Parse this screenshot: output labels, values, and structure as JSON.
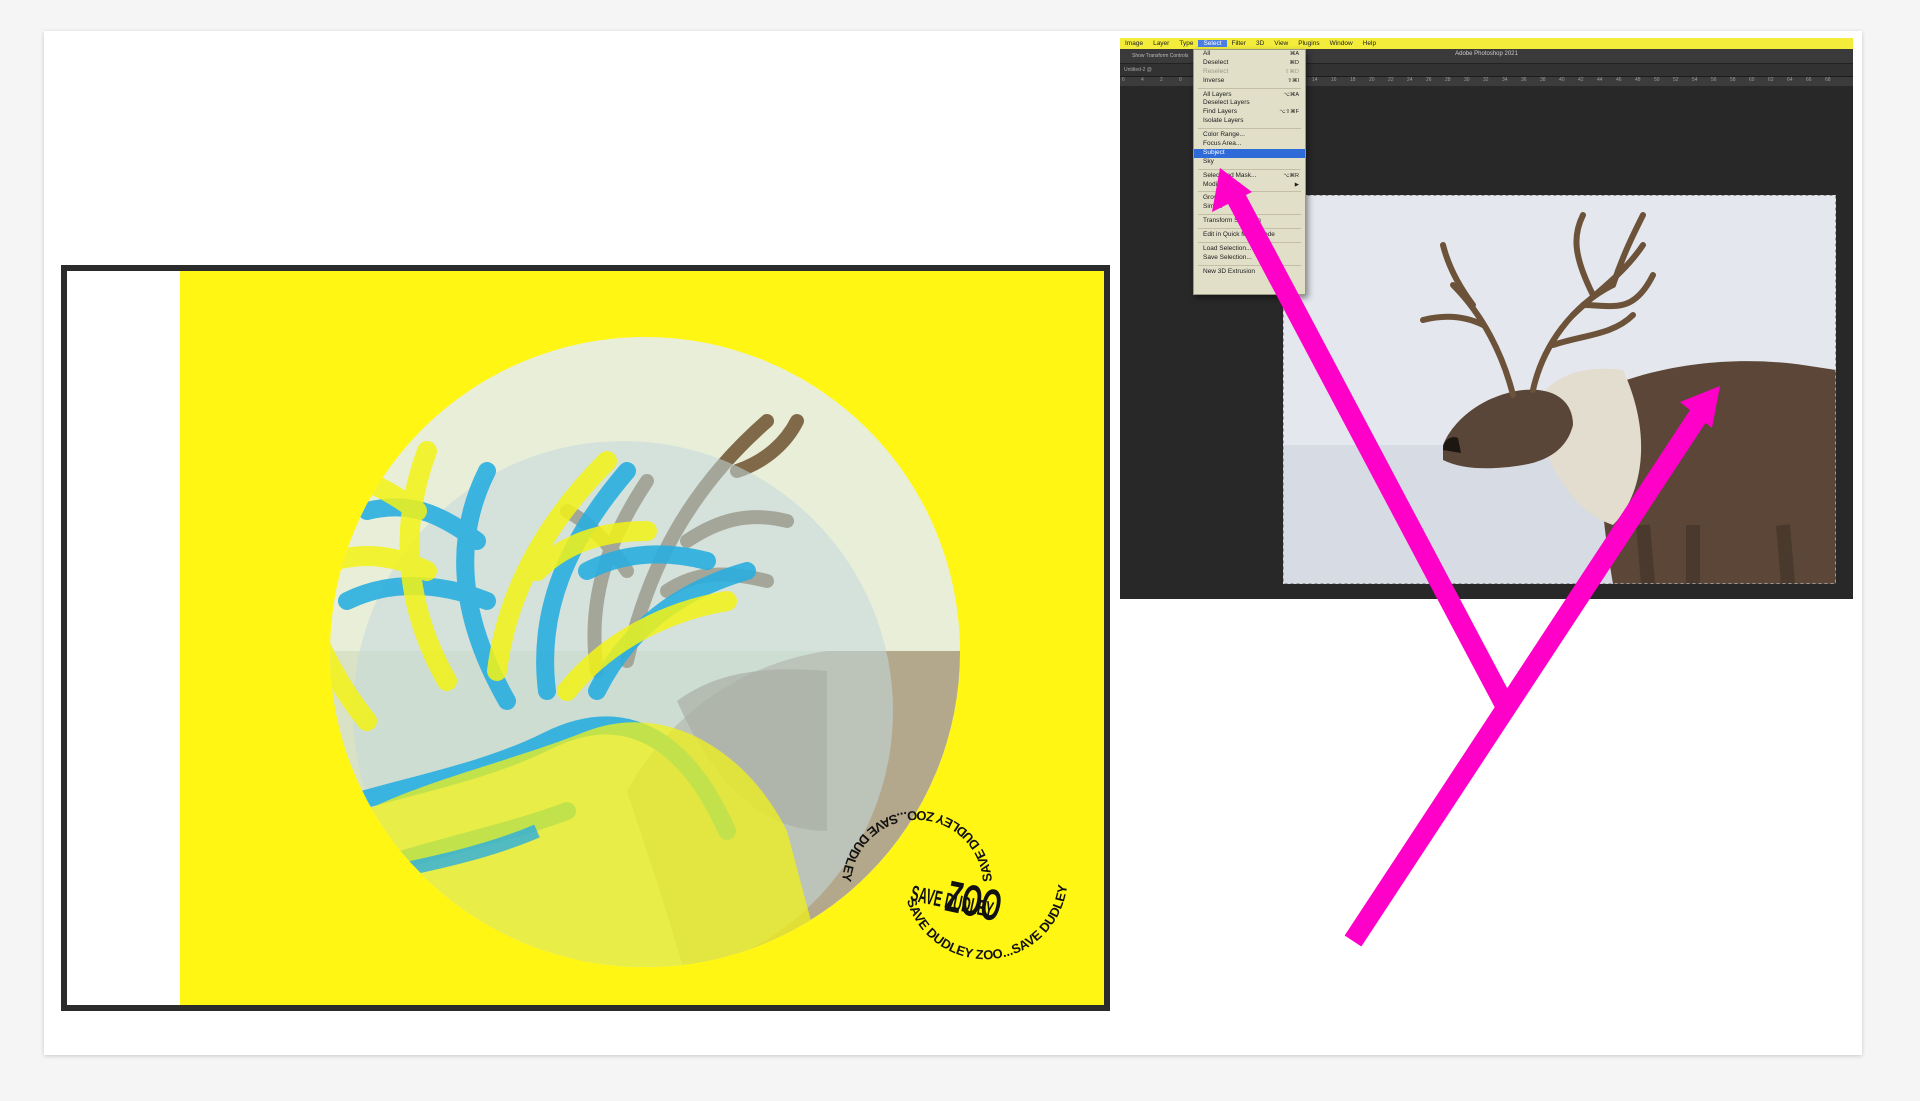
{
  "poster": {
    "circle_text_top": "SAVE DUDLEY ZOO...SAVE DUDLEY",
    "circle_text_bottom": "SAVE DUDLEY ZOO...SAVE DUDLEY",
    "center_text_small": "SAVE DUDLEY",
    "center_text_large": "ZOO",
    "background_color": "#fff614",
    "accent_cyan": "#2aaee0"
  },
  "photoshop": {
    "app_title": "Adobe Photoshop 2021",
    "menubar": [
      "Image",
      "Layer",
      "Type",
      "Select",
      "Filter",
      "3D",
      "View",
      "Plugins",
      "Window",
      "Help"
    ],
    "active_menu": "Select",
    "options_bar_text": "Show Transform Controls",
    "tab_text": "Untitled-2 @",
    "ruler_ticks": [
      "6",
      "4",
      "2",
      "0",
      "2",
      "4",
      "6",
      "8",
      "10",
      "12",
      "14",
      "16",
      "18",
      "20",
      "22",
      "24",
      "26",
      "28",
      "30",
      "32",
      "34",
      "36",
      "38",
      "40",
      "42",
      "44",
      "46",
      "48",
      "50",
      "52",
      "54",
      "56",
      "58",
      "60",
      "62",
      "64",
      "66",
      "68"
    ],
    "select_menu": {
      "group1": [
        {
          "label": "All",
          "shortcut": "⌘A"
        },
        {
          "label": "Deselect",
          "shortcut": "⌘D"
        },
        {
          "label": "Reselect",
          "shortcut": "⇧⌘D",
          "disabled": true
        },
        {
          "label": "Inverse",
          "shortcut": "⇧⌘I"
        }
      ],
      "group2": [
        {
          "label": "All Layers",
          "shortcut": "⌥⌘A"
        },
        {
          "label": "Deselect Layers",
          "shortcut": ""
        },
        {
          "label": "Find Layers",
          "shortcut": "⌥⇧⌘F"
        },
        {
          "label": "Isolate Layers",
          "shortcut": ""
        }
      ],
      "group3": [
        {
          "label": "Color Range...",
          "shortcut": ""
        },
        {
          "label": "Focus Area...",
          "shortcut": ""
        },
        {
          "label": "Subject",
          "shortcut": "",
          "selected": true
        },
        {
          "label": "Sky",
          "shortcut": ""
        }
      ],
      "group4": [
        {
          "label": "Select and Mask...",
          "shortcut": "⌥⌘R"
        },
        {
          "label": "Modify",
          "shortcut": "▶"
        }
      ],
      "group5": [
        {
          "label": "Grow",
          "shortcut": ""
        },
        {
          "label": "Similar",
          "shortcut": ""
        }
      ],
      "group6": [
        {
          "label": "Transform Selection",
          "shortcut": ""
        }
      ],
      "group7": [
        {
          "label": "Edit in Quick Mask Mode",
          "shortcut": ""
        }
      ],
      "group8": [
        {
          "label": "Load Selection...",
          "shortcut": ""
        },
        {
          "label": "Save Selection...",
          "shortcut": ""
        }
      ],
      "group9": [
        {
          "label": "New 3D Extrusion",
          "shortcut": ""
        }
      ]
    }
  },
  "annotation": {
    "color": "#ff00c8"
  }
}
